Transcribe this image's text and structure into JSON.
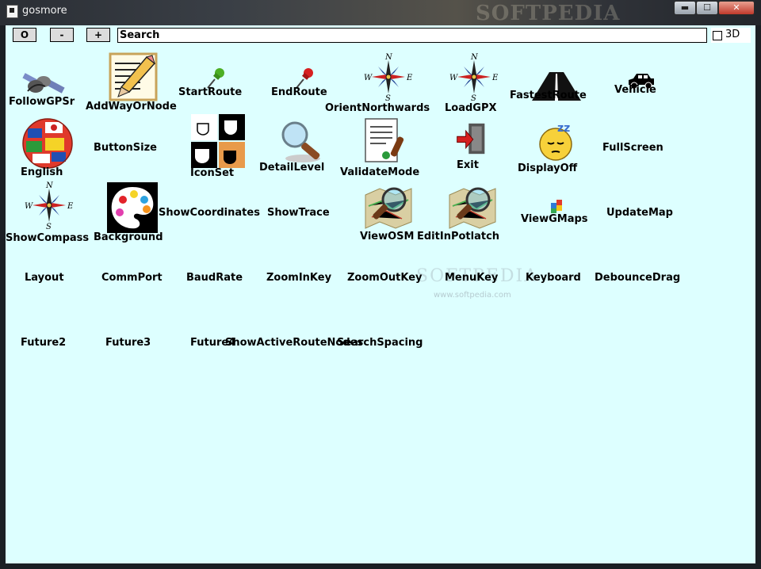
{
  "window": {
    "title": "gosmore",
    "minimize_symbol": "▬",
    "maximize_symbol": "☐",
    "close_symbol": "✕",
    "watermark": "SOFTPEDIA"
  },
  "toolbar": {
    "zoom_reset_label": "O",
    "zoom_out_label": "-",
    "zoom_in_label": "+",
    "search_value": "Search",
    "checkbox_label": "3D",
    "checkbox_checked": false
  },
  "menu_items": [
    {
      "label": "FollowGPSr",
      "icon": "satellite-icon"
    },
    {
      "label": "AddWayOrNode",
      "icon": "pencil-notepad-icon"
    },
    {
      "label": "StartRoute",
      "icon": "green-pin-icon"
    },
    {
      "label": "EndRoute",
      "icon": "red-pin-icon"
    },
    {
      "label": "OrientNorthwards",
      "icon": "compass-rose-icon"
    },
    {
      "label": "LoadGPX",
      "icon": "compass-rose-icon"
    },
    {
      "label": "FastestRoute",
      "icon": "road-icon"
    },
    {
      "label": "Vehicle",
      "icon": "car-icon"
    },
    {
      "label": "English",
      "icon": "flag-globe-icon"
    },
    {
      "label": "ButtonSize",
      "icon": ""
    },
    {
      "label": "IconSet",
      "icon": "cups-icon"
    },
    {
      "label": "DetailLevel",
      "icon": "magnifier-icon"
    },
    {
      "label": "ValidateMode",
      "icon": "document-stamp-icon"
    },
    {
      "label": "Exit",
      "icon": "exit-door-icon"
    },
    {
      "label": "DisplayOff",
      "icon": "sleeping-face-icon"
    },
    {
      "label": "FullScreen",
      "icon": ""
    },
    {
      "label": "ShowCompass",
      "icon": "compass-rose-icon"
    },
    {
      "label": "Background",
      "icon": "paint-palette-icon"
    },
    {
      "label": "ShowCoordinates",
      "icon": ""
    },
    {
      "label": "ShowTrace",
      "icon": ""
    },
    {
      "label": "ViewOSM",
      "icon": "osm-map-magnifier-icon"
    },
    {
      "label": "EditInPotlatch",
      "icon": "osm-map-magnifier-icon"
    },
    {
      "label": "ViewGMaps",
      "icon": "gmaps-icon"
    },
    {
      "label": "UpdateMap",
      "icon": ""
    },
    {
      "label": "Layout",
      "icon": ""
    },
    {
      "label": "CommPort",
      "icon": ""
    },
    {
      "label": "BaudRate",
      "icon": ""
    },
    {
      "label": "ZoomInKey",
      "icon": ""
    },
    {
      "label": "ZoomOutKey",
      "icon": ""
    },
    {
      "label": "MenuKey",
      "icon": ""
    },
    {
      "label": "Keyboard",
      "icon": ""
    },
    {
      "label": "DebounceDrag",
      "icon": ""
    },
    {
      "label": "Future2",
      "icon": ""
    },
    {
      "label": "Future3",
      "icon": ""
    },
    {
      "label": "Future4",
      "icon": ""
    },
    {
      "label": "ShowActiveRouteNodes",
      "icon": ""
    },
    {
      "label": "SearchSpacing",
      "icon": ""
    }
  ],
  "compass": {
    "n": "N",
    "s": "S",
    "e": "E",
    "w": "W"
  },
  "watermark_mid": "SOFTPEDIA",
  "watermark_sub": "www.softpedia.com"
}
